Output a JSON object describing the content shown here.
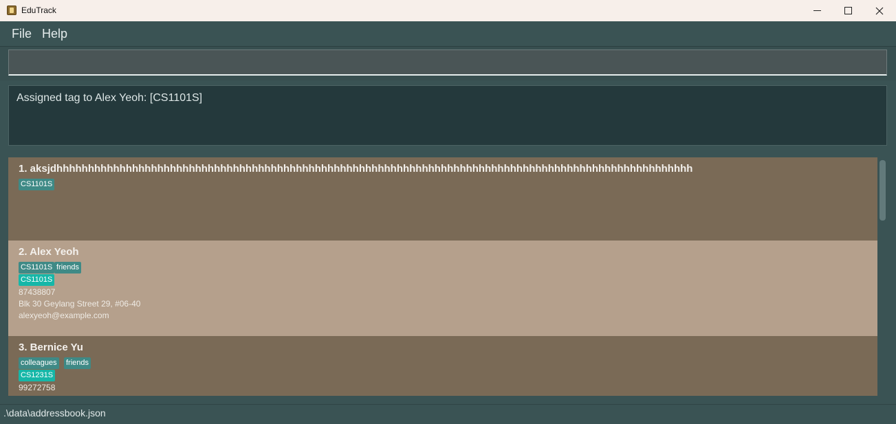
{
  "window": {
    "title": "EduTrack",
    "icon": "address-book-icon"
  },
  "menu": {
    "file": "File",
    "help": "Help"
  },
  "command": {
    "value": "",
    "placeholder": ""
  },
  "result": {
    "message": "Assigned tag to Alex Yeoh: [CS1101S]"
  },
  "persons": [
    {
      "name": "1. aksjdhhhhhhhhhhhhhhhhhhhhhhhhhhhhhhhhhhhhhhhhhhhhhhhhhhhhhhhhhhhhhhhhhhhhhhhhhhhhhhhhhhhhhhhhhhhhhhhhhhhhh",
      "tags": [
        "CS1101S"
      ]
    },
    {
      "name": "2. Alex Yeoh",
      "tags": [
        "CS1101S",
        "friends"
      ],
      "modules": [
        "CS1101S"
      ],
      "phone": "87438807",
      "address": "Blk 30 Geylang Street 29, #06-40",
      "email": "alexyeoh@example.com"
    },
    {
      "name": "3. Bernice Yu",
      "tags": [
        "colleagues",
        "friends"
      ],
      "modules": [
        "CS1231S"
      ],
      "phone": "99272758"
    }
  ],
  "status": {
    "path": ".\\data\\addressbook.json"
  },
  "colors": {
    "tag": "#3f8a86",
    "module_tag": "#16b7a8",
    "card_dark": "#7a6a56",
    "card_selected": "#b5a08c",
    "panel": "#3a5354"
  }
}
